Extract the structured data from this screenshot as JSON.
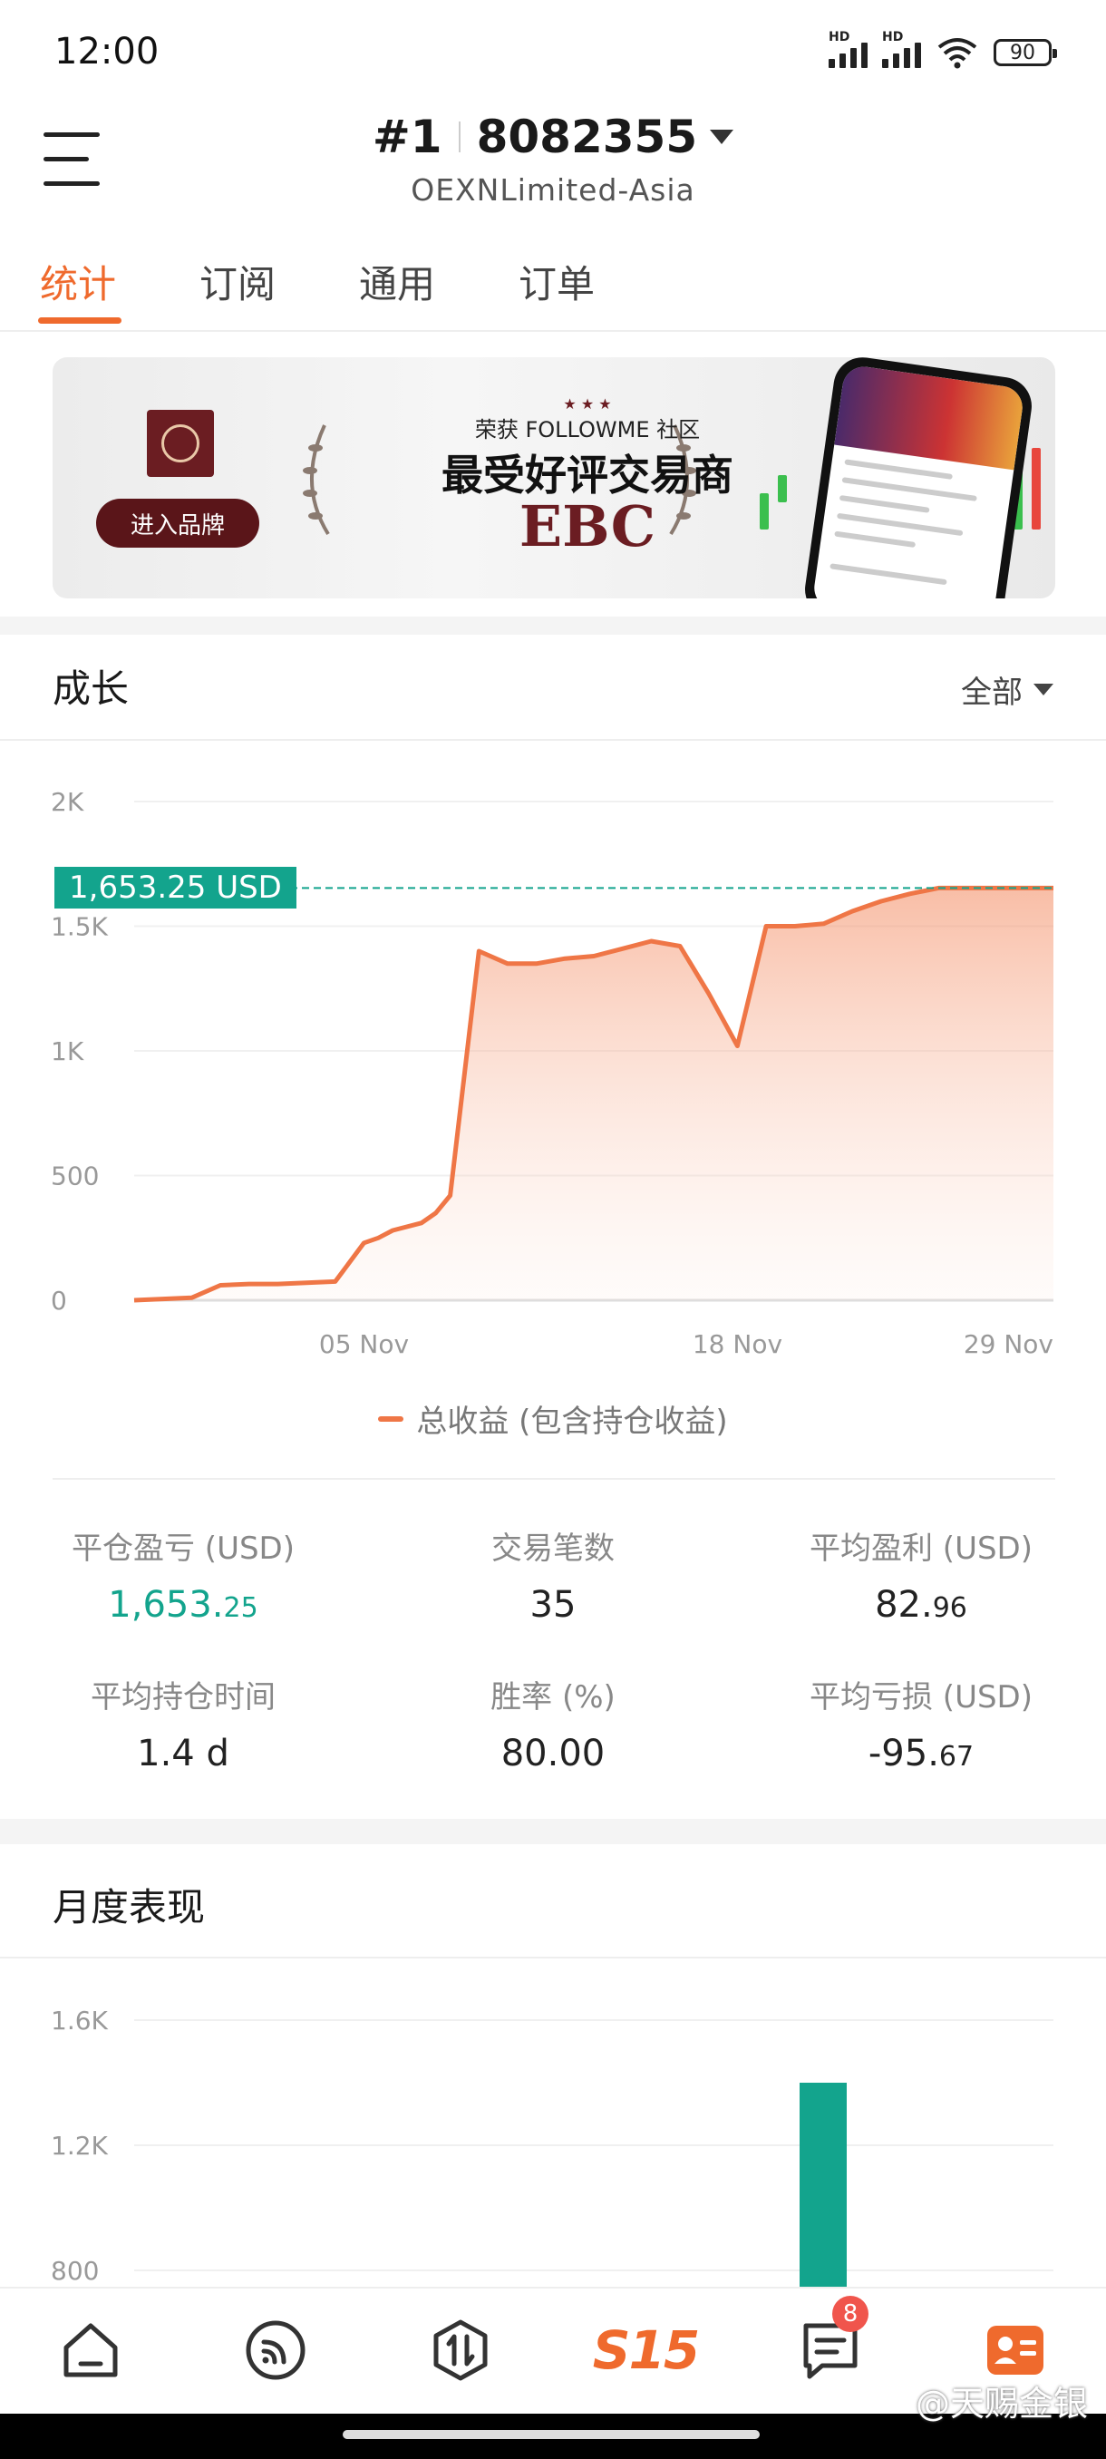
{
  "status_bar": {
    "time": "12:00",
    "network_1": "HD",
    "network_2": "HD",
    "battery": "90"
  },
  "header": {
    "rank": "#1",
    "account_id": "8082355",
    "broker": "OEXNLimited-Asia"
  },
  "tabs": [
    {
      "label": "统计",
      "active": true
    },
    {
      "label": "订阅",
      "active": false
    },
    {
      "label": "通用",
      "active": false
    },
    {
      "label": "订单",
      "active": false
    }
  ],
  "banner": {
    "enter_brand": "进入品牌",
    "award_sub": "荣获 FOLLOWME 社区",
    "award_title": "最受好评交易商",
    "brand": "EBC"
  },
  "growth": {
    "title": "成长",
    "range": "全部",
    "current_badge": "1,653.25 USD",
    "legend": "总收益 (包含持仓收益)"
  },
  "chart_data": [
    {
      "type": "area",
      "y_ticks": [
        "0",
        "500",
        "1K",
        "1.5K",
        "2K"
      ],
      "ylim": [
        0,
        2000
      ],
      "x_ticks": [
        "05 Nov",
        "18 Nov",
        "29 Nov"
      ],
      "x_tick_positions": [
        8,
        21,
        32
      ],
      "xlim": [
        0,
        32
      ],
      "series": [
        {
          "name": "总收益 (包含持仓收益)",
          "color": "#ef7646",
          "x": [
            0,
            1,
            2,
            3,
            4,
            5,
            6,
            7,
            8,
            8.5,
            9,
            10,
            10.5,
            11,
            12,
            13,
            14,
            15,
            16,
            17,
            18,
            19,
            20,
            21,
            22,
            23,
            24,
            25,
            26,
            27,
            28,
            29,
            30,
            31,
            32
          ],
          "y": [
            0,
            5,
            10,
            60,
            65,
            65,
            70,
            75,
            230,
            250,
            280,
            310,
            350,
            420,
            1400,
            1350,
            1350,
            1370,
            1380,
            1410,
            1440,
            1420,
            1230,
            1020,
            1500,
            1500,
            1510,
            1560,
            1600,
            1630,
            1653,
            1653,
            1653,
            1653,
            1653
          ]
        }
      ],
      "reference_line": 1653.25
    },
    {
      "type": "bar",
      "y_ticks": [
        "800",
        "1.2K",
        "1.6K"
      ],
      "ylim": [
        800,
        1600
      ],
      "series": [
        {
          "color": "#13a48d",
          "values": [
            1400
          ]
        }
      ]
    }
  ],
  "stats": [
    {
      "label": "平仓盈亏 (USD)",
      "value_main": "1,653.",
      "value_dec": "25",
      "color": "green"
    },
    {
      "label": "交易笔数",
      "value_main": "35",
      "value_dec": ""
    },
    {
      "label": "平均盈利 (USD)",
      "value_main": "82.",
      "value_dec": "96"
    },
    {
      "label": "平均持仓时间",
      "value_main": "1.4 d",
      "value_dec": ""
    },
    {
      "label": "胜率 (%)",
      "value_main": "80.00",
      "value_dec": ""
    },
    {
      "label": "平均亏损 (USD)",
      "value_main": "-95.",
      "value_dec": "67"
    }
  ],
  "monthly": {
    "title": "月度表现"
  },
  "bottom_nav": {
    "items": [
      "home",
      "feed",
      "trade",
      "s15",
      "messages",
      "profile"
    ],
    "s15_label": "S15",
    "messages_badge": "8"
  },
  "watermark": "@天赐金银"
}
